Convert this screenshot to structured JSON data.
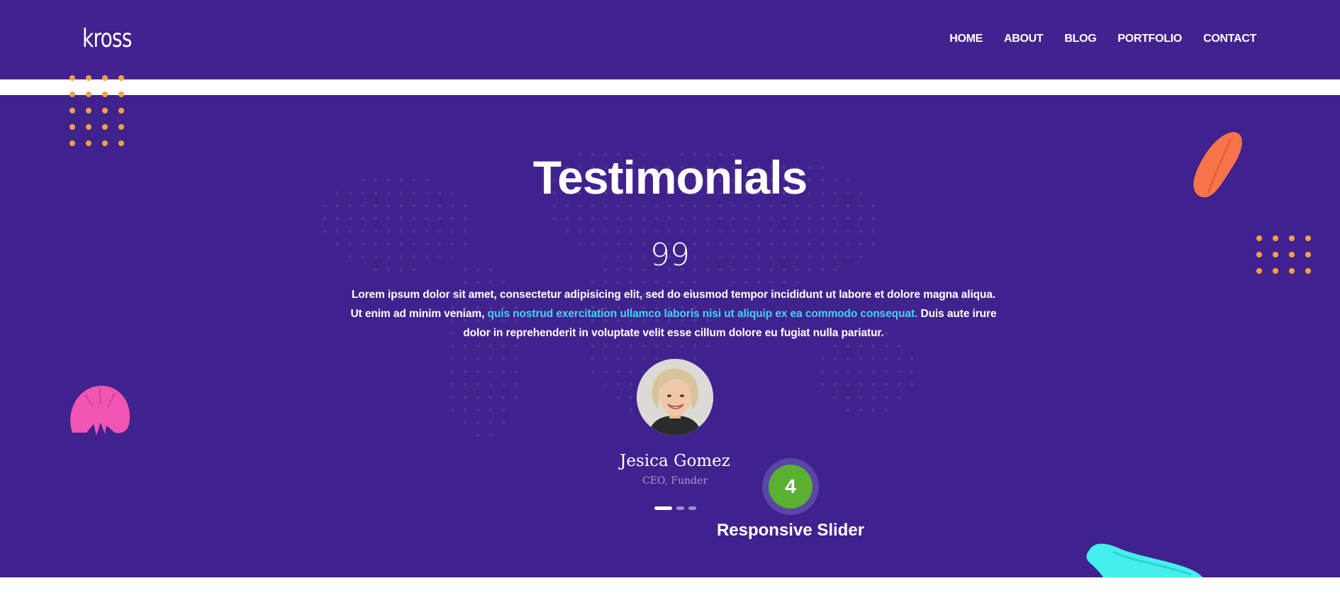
{
  "header": {
    "logo": "kross",
    "nav": [
      "HOME",
      "ABOUT",
      "BLOG",
      "PORTFOLIO",
      "CONTACT"
    ]
  },
  "testimonials": {
    "title": "Testimonials",
    "quote_mark": "99",
    "text_before": "Lorem ipsum dolor sit amet, consectetur adipisicing elit, sed do eiusmod tempor incididunt ut labore et dolore magna aliqua. Ut enim ad minim veniam, ",
    "text_highlight": "quis nostrud exercitation ullamco laboris nisi ut aliquip ex ea commodo consequat.",
    "text_after": " Duis aute irure dolor in reprehenderit in voluptate velit esse cillum dolore eu fugiat nulla pariatur.",
    "person_name": "Jesica Gomez",
    "person_role": "CEO, Funder",
    "slide_count": 3,
    "active_slide": 1
  },
  "badge": {
    "number": "4",
    "label": "Responsive Slider"
  },
  "colors": {
    "background": "#40228e",
    "highlight": "#3fd7ee",
    "badge": "#5cb031",
    "orange_dots": "#f7a13c",
    "pink_shape": "#f055b1",
    "coral_shape": "#f9744a",
    "cyan_shape": "#44f0ee"
  }
}
